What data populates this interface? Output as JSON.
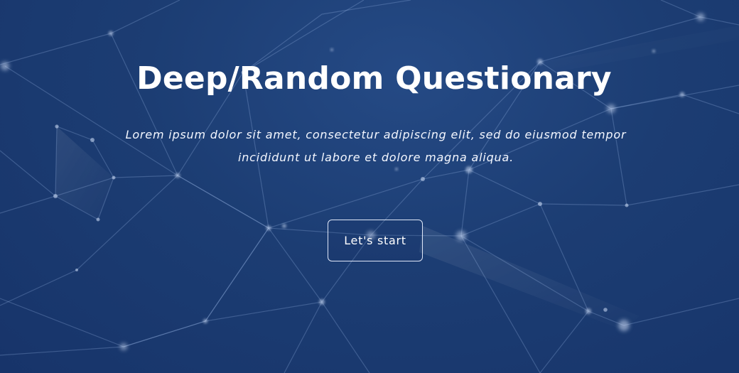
{
  "hero": {
    "title": "Deep/Random Questionary",
    "subtitle": "Lorem ipsum dolor sit amet, consectetur adipiscing elit, sed do eiusmod tempor incididunt ut labore et dolore magna aliqua.",
    "button_label": "Let's start"
  },
  "colors": {
    "background": "#1c3d73",
    "text": "#ffffff",
    "button_border": "#dfe7f8"
  }
}
